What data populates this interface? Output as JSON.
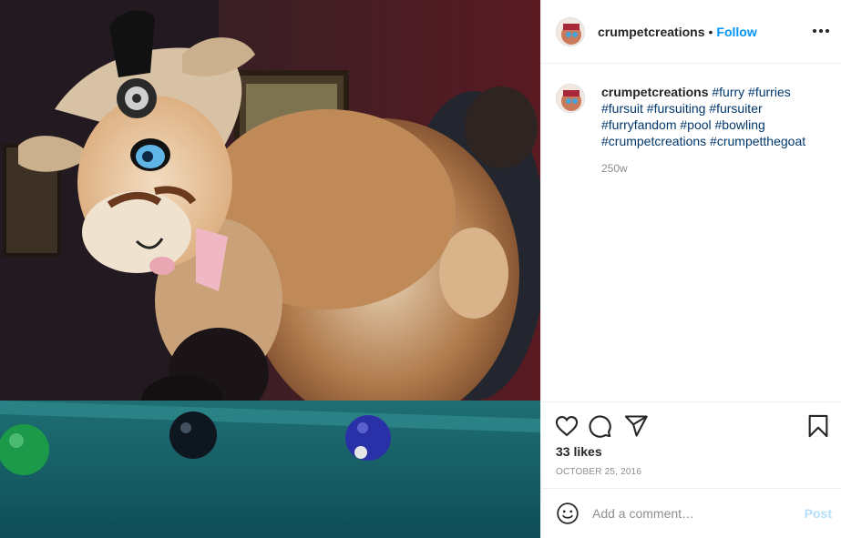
{
  "post": {
    "username": "crumpetcreations",
    "dot": "•",
    "follow_label": "Follow",
    "caption_username": "crumpetcreations",
    "caption_tags": "#furry #furries #fursuit #fursuiting #fursuiter #furryfandom #pool #bowling #crumpetcreations #crumpetthegoat",
    "caption_time": "250w",
    "likes": "33 likes",
    "date": "OCTOBER 25, 2016",
    "comment_placeholder": "Add a comment…",
    "post_label": "Post"
  },
  "photo": {
    "description": "fursuit-goat-at-pool-table"
  },
  "colors": {
    "link": "#0095f6",
    "hashtag": "#00376b",
    "muted": "#8e8e8e",
    "post_disabled": "#b2dffc"
  },
  "icons": [
    "heart-icon",
    "comment-icon",
    "share-icon",
    "bookmark-icon",
    "more-icon",
    "emoji-icon"
  ]
}
